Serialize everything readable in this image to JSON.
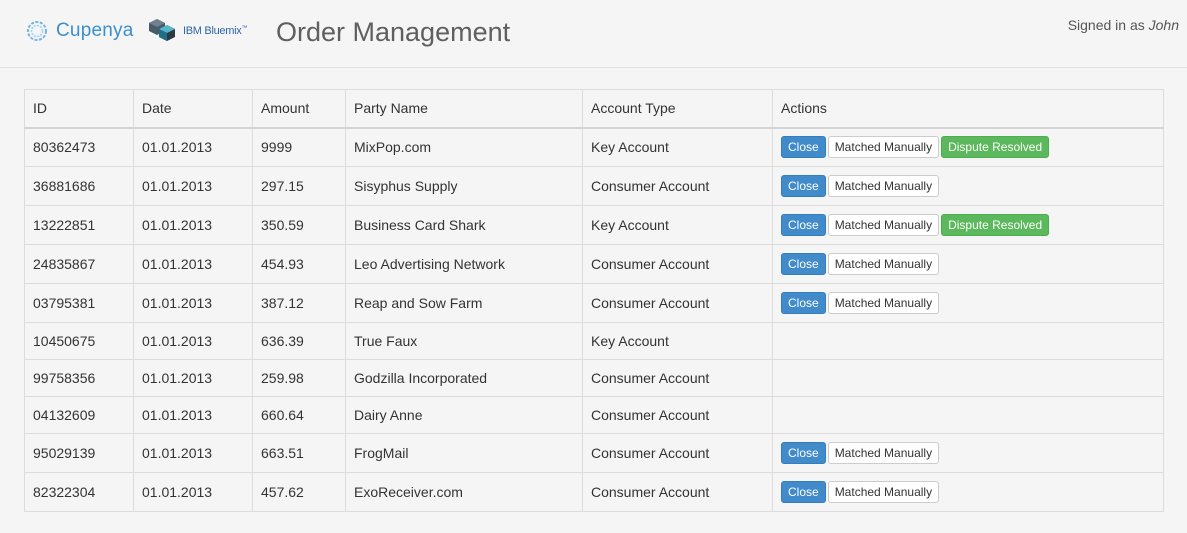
{
  "header": {
    "brand": "Cupenya",
    "partner": "IBM Bluemix",
    "partner_tm": "™",
    "title": "Order Management",
    "signed_in_prefix": "Signed in as",
    "user": "John"
  },
  "table": {
    "columns": [
      "ID",
      "Date",
      "Amount",
      "Party Name",
      "Account Type",
      "Actions"
    ],
    "rows": [
      {
        "id": "80362473",
        "date": "01.01.2013",
        "amount": "9999",
        "party": "MixPop.com",
        "account": "Key Account",
        "actions": [
          "Close",
          "Matched Manually",
          "Dispute Resolved"
        ]
      },
      {
        "id": "36881686",
        "date": "01.01.2013",
        "amount": "297.15",
        "party": "Sisyphus Supply",
        "account": "Consumer Account",
        "actions": [
          "Close",
          "Matched Manually"
        ]
      },
      {
        "id": "13222851",
        "date": "01.01.2013",
        "amount": "350.59",
        "party": "Business Card Shark",
        "account": "Key Account",
        "actions": [
          "Close",
          "Matched Manually",
          "Dispute Resolved"
        ]
      },
      {
        "id": "24835867",
        "date": "01.01.2013",
        "amount": "454.93",
        "party": "Leo Advertising Network",
        "account": "Consumer Account",
        "actions": [
          "Close",
          "Matched Manually"
        ]
      },
      {
        "id": "03795381",
        "date": "01.01.2013",
        "amount": "387.12",
        "party": "Reap and Sow Farm",
        "account": "Consumer Account",
        "actions": [
          "Close",
          "Matched Manually"
        ]
      },
      {
        "id": "10450675",
        "date": "01.01.2013",
        "amount": "636.39",
        "party": "True Faux",
        "account": "Key Account",
        "actions": []
      },
      {
        "id": "99758356",
        "date": "01.01.2013",
        "amount": "259.98",
        "party": "Godzilla Incorporated",
        "account": "Consumer Account",
        "actions": []
      },
      {
        "id": "04132609",
        "date": "01.01.2013",
        "amount": "660.64",
        "party": "Dairy Anne",
        "account": "Consumer Account",
        "actions": []
      },
      {
        "id": "95029139",
        "date": "01.01.2013",
        "amount": "663.51",
        "party": "FrogMail",
        "account": "Consumer Account",
        "actions": [
          "Close",
          "Matched Manually"
        ]
      },
      {
        "id": "82322304",
        "date": "01.01.2013",
        "amount": "457.62",
        "party": "ExoReceiver.com",
        "account": "Consumer Account",
        "actions": [
          "Close",
          "Matched Manually"
        ]
      }
    ]
  },
  "colors": {
    "close": "#428bca",
    "matched": "#ffffff",
    "resolved": "#5cb85c",
    "brand": "#3a8fcf"
  }
}
